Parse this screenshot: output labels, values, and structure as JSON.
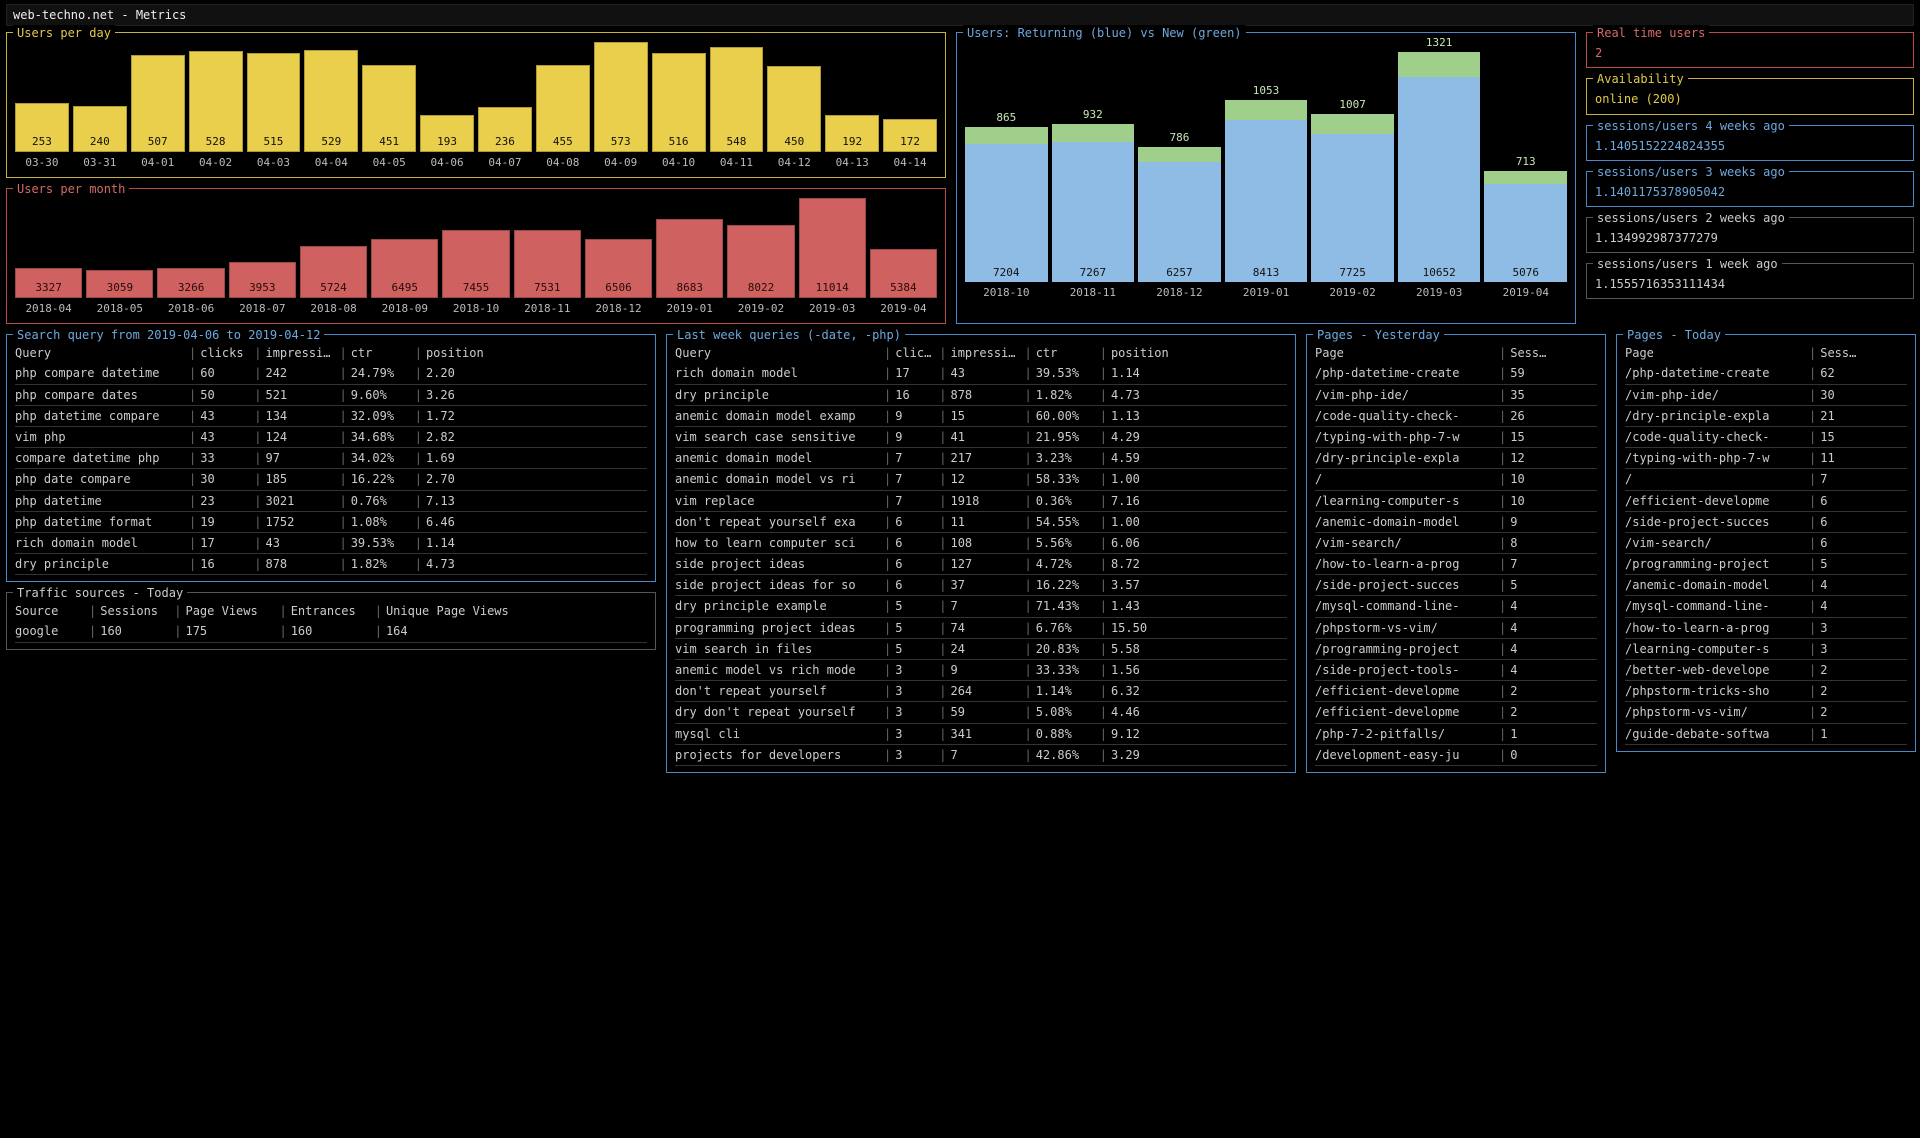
{
  "title": "web-techno.net - Metrics",
  "chart_data": [
    {
      "id": "users_day",
      "type": "bar",
      "title": "Users per day",
      "color": "#e9cf4b",
      "categories": [
        "03-30",
        "03-31",
        "04-01",
        "04-02",
        "04-03",
        "04-04",
        "04-05",
        "04-06",
        "04-07",
        "04-08",
        "04-09",
        "04-10",
        "04-11",
        "04-12",
        "04-13",
        "04-14"
      ],
      "values": [
        253,
        240,
        507,
        528,
        515,
        529,
        451,
        193,
        236,
        455,
        573,
        516,
        548,
        450,
        192,
        172
      ]
    },
    {
      "id": "users_month",
      "type": "bar",
      "title": "Users per month",
      "color": "#cf6161",
      "categories": [
        "2018-04",
        "2018-05",
        "2018-06",
        "2018-07",
        "2018-08",
        "2018-09",
        "2018-10",
        "2018-11",
        "2018-12",
        "2019-01",
        "2019-02",
        "2019-03",
        "2019-04"
      ],
      "values": [
        3327,
        3059,
        3266,
        3953,
        5724,
        6495,
        7455,
        7531,
        6506,
        8683,
        8022,
        11014,
        5384
      ]
    },
    {
      "id": "returning_new",
      "type": "bar",
      "title": "Users: Returning (blue) vs New (green)",
      "categories": [
        "2018-10",
        "2018-11",
        "2018-12",
        "2019-01",
        "2019-02",
        "2019-03",
        "2019-04"
      ],
      "series": [
        {
          "name": "Returning",
          "color": "#8fbce5",
          "values": [
            7204,
            7267,
            6257,
            8413,
            7725,
            10652,
            5076
          ]
        },
        {
          "name": "New",
          "color": "#9fcf8a",
          "values": [
            865,
            932,
            786,
            1053,
            1007,
            1321,
            713
          ]
        }
      ]
    }
  ],
  "realtime": {
    "title": "Real time users",
    "value": "2"
  },
  "availability": {
    "title": "Availability",
    "value": "online (200)"
  },
  "ratios": [
    {
      "title": "sessions/users 4 weeks ago",
      "value": "1.1405152224824355",
      "style": "blue"
    },
    {
      "title": "sessions/users 3 weeks ago",
      "value": "1.1401175378905042",
      "style": "blue"
    },
    {
      "title": "sessions/users 2 weeks ago",
      "value": "1.134992987377279",
      "style": "grey"
    },
    {
      "title": "sessions/users 1 week ago",
      "value": "1.1555716353111434",
      "style": "grey"
    }
  ],
  "search_queries": {
    "title": "Search query from 2019-04-06 to 2019-04-12",
    "headers": [
      "Query",
      "clicks",
      "impressions",
      "ctr",
      "position"
    ],
    "rows": [
      [
        "php compare datetime",
        "60",
        "242",
        "24.79%",
        "2.20"
      ],
      [
        "php compare dates",
        "50",
        "521",
        "9.60%",
        "3.26"
      ],
      [
        "php datetime compare",
        "43",
        "134",
        "32.09%",
        "1.72"
      ],
      [
        "vim php",
        "43",
        "124",
        "34.68%",
        "2.82"
      ],
      [
        "compare datetime php",
        "33",
        "97",
        "34.02%",
        "1.69"
      ],
      [
        "php date compare",
        "30",
        "185",
        "16.22%",
        "2.70"
      ],
      [
        "php datetime",
        "23",
        "3021",
        "0.76%",
        "7.13"
      ],
      [
        "php datetime format",
        "19",
        "1752",
        "1.08%",
        "6.46"
      ],
      [
        "rich domain model",
        "17",
        "43",
        "39.53%",
        "1.14"
      ],
      [
        "dry principle",
        "16",
        "878",
        "1.82%",
        "4.73"
      ]
    ]
  },
  "last_week_queries": {
    "title": "Last week queries (-date, -php)",
    "headers": [
      "Query",
      "clicks",
      "impressions",
      "ctr",
      "position"
    ],
    "rows": [
      [
        "rich domain model",
        "17",
        "43",
        "39.53%",
        "1.14"
      ],
      [
        "dry principle",
        "16",
        "878",
        "1.82%",
        "4.73"
      ],
      [
        "anemic domain model examp",
        "9",
        "15",
        "60.00%",
        "1.13"
      ],
      [
        "vim search case sensitive",
        "9",
        "41",
        "21.95%",
        "4.29"
      ],
      [
        "anemic domain model",
        "7",
        "217",
        "3.23%",
        "4.59"
      ],
      [
        "anemic domain model vs ri",
        "7",
        "12",
        "58.33%",
        "1.00"
      ],
      [
        "vim replace",
        "7",
        "1918",
        "0.36%",
        "7.16"
      ],
      [
        "don't repeat yourself exa",
        "6",
        "11",
        "54.55%",
        "1.00"
      ],
      [
        "how to learn computer sci",
        "6",
        "108",
        "5.56%",
        "6.06"
      ],
      [
        "side project ideas",
        "6",
        "127",
        "4.72%",
        "8.72"
      ],
      [
        "side project ideas for so",
        "6",
        "37",
        "16.22%",
        "3.57"
      ],
      [
        "dry principle example",
        "5",
        "7",
        "71.43%",
        "1.43"
      ],
      [
        "programming project ideas",
        "5",
        "74",
        "6.76%",
        "15.50"
      ],
      [
        "vim search in files",
        "5",
        "24",
        "20.83%",
        "5.58"
      ],
      [
        "anemic model vs rich mode",
        "3",
        "9",
        "33.33%",
        "1.56"
      ],
      [
        "don't repeat yourself",
        "3",
        "264",
        "1.14%",
        "6.32"
      ],
      [
        "dry don't repeat yourself",
        "3",
        "59",
        "5.08%",
        "4.46"
      ],
      [
        "mysql cli",
        "3",
        "341",
        "0.88%",
        "9.12"
      ],
      [
        "projects for developers",
        "3",
        "7",
        "42.86%",
        "3.29"
      ]
    ]
  },
  "traffic_sources": {
    "title": "Traffic sources - Today",
    "headers": [
      "Source",
      "Sessions",
      "Page Views",
      "Entrances",
      "Unique Page Views"
    ],
    "rows": [
      [
        "google",
        "160",
        "175",
        "160",
        "164"
      ]
    ]
  },
  "pages_yesterday": {
    "title": "Pages - Yesterday",
    "headers": [
      "Page",
      "Sessions"
    ],
    "rows": [
      [
        "/php-datetime-create",
        "59"
      ],
      [
        "/vim-php-ide/",
        "35"
      ],
      [
        "/code-quality-check-",
        "26"
      ],
      [
        "/typing-with-php-7-w",
        "15"
      ],
      [
        "/dry-principle-expla",
        "12"
      ],
      [
        "/",
        "10"
      ],
      [
        "/learning-computer-s",
        "10"
      ],
      [
        "/anemic-domain-model",
        "9"
      ],
      [
        "/vim-search/",
        "8"
      ],
      [
        "/how-to-learn-a-prog",
        "7"
      ],
      [
        "/side-project-succes",
        "5"
      ],
      [
        "/mysql-command-line-",
        "4"
      ],
      [
        "/phpstorm-vs-vim/",
        "4"
      ],
      [
        "/programming-project",
        "4"
      ],
      [
        "/side-project-tools-",
        "4"
      ],
      [
        "/efficient-developme",
        "2"
      ],
      [
        "/efficient-developme",
        "2"
      ],
      [
        "/php-7-2-pitfalls/",
        "1"
      ],
      [
        "/development-easy-ju",
        "0"
      ]
    ]
  },
  "pages_today": {
    "title": "Pages - Today",
    "headers": [
      "Page",
      "Sessions"
    ],
    "rows": [
      [
        "/php-datetime-create",
        "62"
      ],
      [
        "/vim-php-ide/",
        "30"
      ],
      [
        "/dry-principle-expla",
        "21"
      ],
      [
        "/code-quality-check-",
        "15"
      ],
      [
        "/typing-with-php-7-w",
        "11"
      ],
      [
        "/",
        "7"
      ],
      [
        "/efficient-developme",
        "6"
      ],
      [
        "/side-project-succes",
        "6"
      ],
      [
        "/vim-search/",
        "6"
      ],
      [
        "/programming-project",
        "5"
      ],
      [
        "/anemic-domain-model",
        "4"
      ],
      [
        "/mysql-command-line-",
        "4"
      ],
      [
        "/how-to-learn-a-prog",
        "3"
      ],
      [
        "/learning-computer-s",
        "3"
      ],
      [
        "/better-web-develope",
        "2"
      ],
      [
        "/phpstorm-tricks-sho",
        "2"
      ],
      [
        "/phpstorm-vs-vim/",
        "2"
      ],
      [
        "/guide-debate-softwa",
        "1"
      ]
    ]
  }
}
